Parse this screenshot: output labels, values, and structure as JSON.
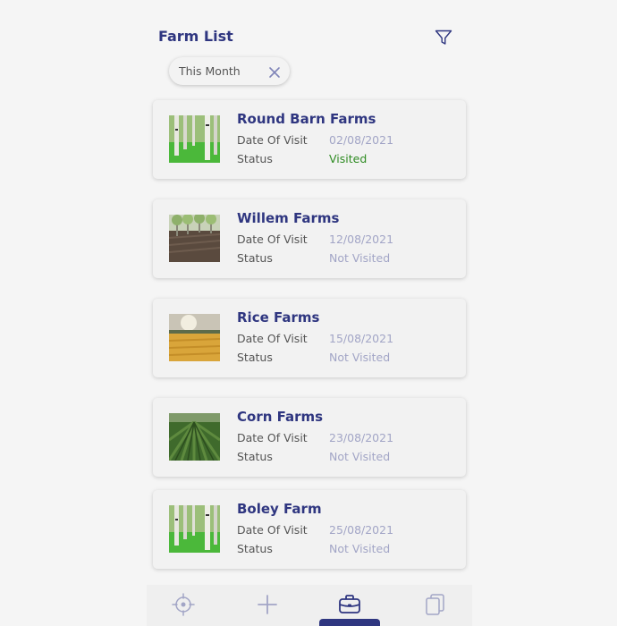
{
  "header": {
    "title": "Farm List"
  },
  "filter_chip": {
    "label": "This Month"
  },
  "labels": {
    "date_of_visit": "Date Of Visit",
    "status": "Status"
  },
  "farms": [
    {
      "name": "Round Barn Farms",
      "date": "02/08/2021",
      "status": "Visited",
      "image": "birch-trees"
    },
    {
      "name": "Willem Farms",
      "date": "12/08/2021",
      "status": "Not Visited",
      "image": "plowed-field-trees"
    },
    {
      "name": "Rice Farms",
      "date": "15/08/2021",
      "status": "Not Visited",
      "image": "wheat-field"
    },
    {
      "name": "Corn Farms",
      "date": "23/08/2021",
      "status": "Not Visited",
      "image": "corn-rows"
    },
    {
      "name": "Boley Farm",
      "date": "25/08/2021",
      "status": "Not Visited",
      "image": "birch-trees"
    }
  ],
  "bottom_nav": {
    "items": [
      "crosshair-icon",
      "plus-icon",
      "briefcase-icon",
      "documents-icon"
    ],
    "active": "briefcase-icon"
  },
  "colors": {
    "accent": "#2f3680",
    "visited": "#2e8b22",
    "muted_value": "#a2a5c6",
    "background": "#f5f5f5"
  }
}
